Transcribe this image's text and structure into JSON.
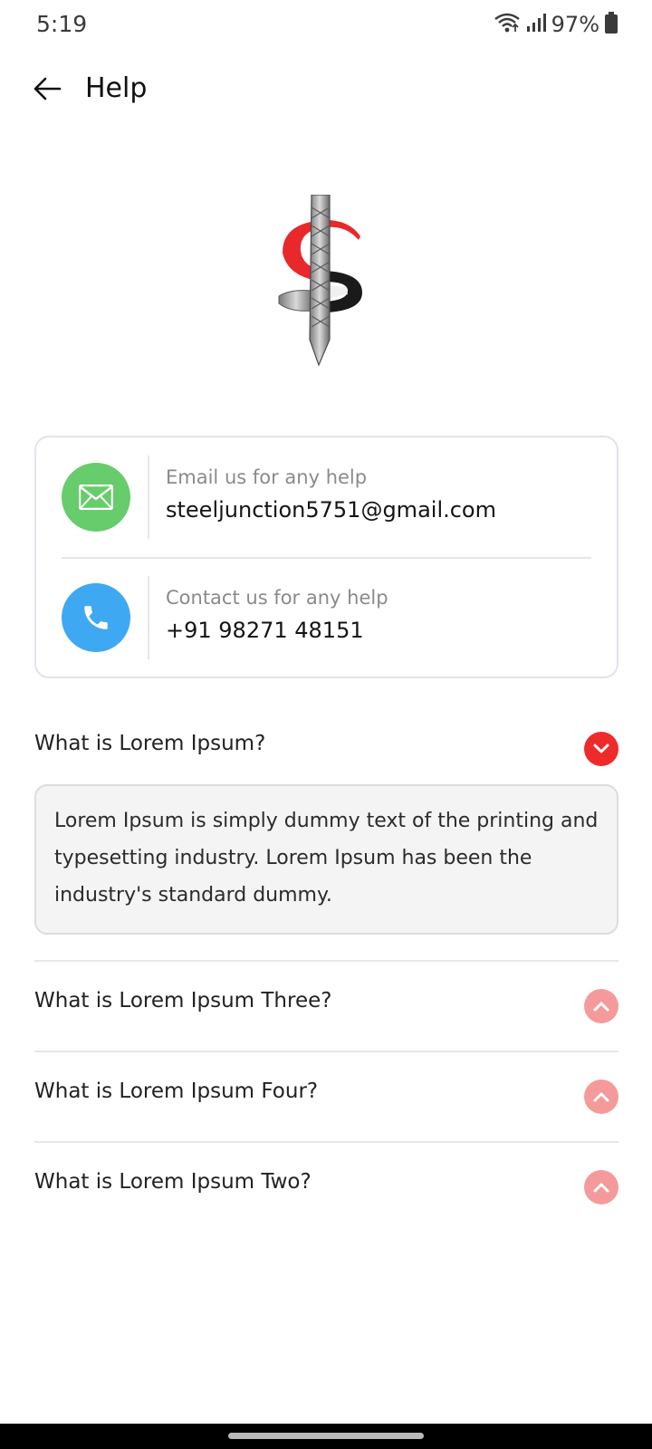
{
  "status_bar": {
    "time": "5:19",
    "battery": "97%",
    "icons": [
      "wifi-icon",
      "signal-icon",
      "battery-icon"
    ]
  },
  "app_bar": {
    "title": "Help",
    "back_icon": "arrow-left-icon"
  },
  "logo": {
    "name": "steel-junction-logo"
  },
  "contact": {
    "email": {
      "icon": "mail-icon",
      "caption": "Email us for any help",
      "value": "steeljunction5751@gmail.com",
      "color": "#67cc6b"
    },
    "phone": {
      "icon": "phone-icon",
      "caption": "Contact us for any help",
      "value": "+91 98271 48151",
      "color": "#3fa8f2"
    }
  },
  "faq": {
    "items": [
      {
        "question": "What is Lorem Ipsum?",
        "answer": "Lorem Ipsum is simply dummy text of the printing and typesetting industry. Lorem Ipsum has been the industry's standard dummy.",
        "expanded": true
      },
      {
        "question": "What is Lorem Ipsum Three?",
        "expanded": false
      },
      {
        "question": "What is Lorem Ipsum Four?",
        "expanded": false
      },
      {
        "question": "What is Lorem Ipsum Two?",
        "expanded": false
      }
    ],
    "colors": {
      "active": "#ef2a2a",
      "inactive": "#f59a9a"
    }
  }
}
